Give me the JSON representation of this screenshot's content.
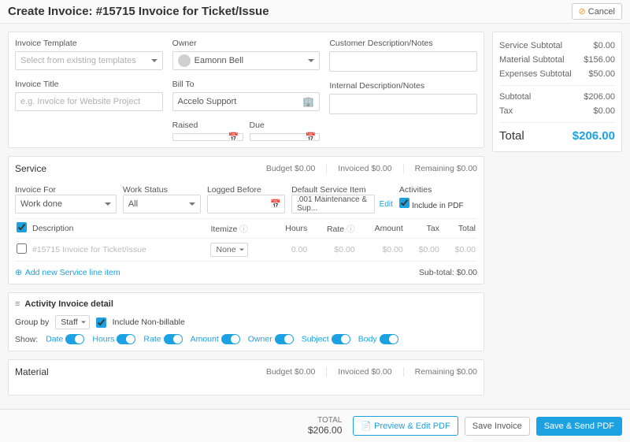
{
  "header": {
    "title": "Create Invoice: #15715 Invoice for Ticket/Issue",
    "cancel": "Cancel"
  },
  "summary": {
    "service_label": "Service Subtotal",
    "service_val": "$0.00",
    "material_label": "Material Subtotal",
    "material_val": "$156.00",
    "expenses_label": "Expenses Subtotal",
    "expenses_val": "$50.00",
    "subtotal_label": "Subtotal",
    "subtotal_val": "$206.00",
    "tax_label": "Tax",
    "tax_val": "$0.00",
    "total_label": "Total",
    "total_val": "$206.00"
  },
  "top": {
    "template_label": "Invoice Template",
    "template_placeholder": "Select from existing templates",
    "title_label": "Invoice Title",
    "title_placeholder": "e.g. Invoice for Website Project",
    "owner_label": "Owner",
    "owner_value": "Eamonn Bell",
    "billto_label": "Bill To",
    "billto_value": "Accelo Support",
    "raised_label": "Raised",
    "due_label": "Due",
    "cust_notes_label": "Customer Description/Notes",
    "int_notes_label": "Internal Description/Notes"
  },
  "service": {
    "title": "Service",
    "budget": "Budget $0.00",
    "invoiced": "Invoiced $0.00",
    "remaining": "Remaining $0.00",
    "invoice_for_label": "Invoice For",
    "invoice_for_value": "Work done",
    "work_status_label": "Work Status",
    "work_status_value": "All",
    "logged_before_label": "Logged Before",
    "default_item_label": "Default Service Item",
    "default_item_value": ".001 Maintenance & Sup...",
    "edit": "Edit",
    "activities_label": "Activities",
    "include_pdf": "Include in PDF",
    "col_desc": "Description",
    "col_itemize": "Itemize",
    "col_hours": "Hours",
    "col_rate": "Rate",
    "col_amount": "Amount",
    "col_tax": "Tax",
    "col_total": "Total",
    "row_desc": "#15715 Invoice for Ticket/Issue",
    "row_itemize": "None",
    "row_hours": "0.00",
    "row_rate": "$0.00",
    "row_amount": "$0.00",
    "row_tax": "$0.00",
    "row_total": "$0.00",
    "add_link": "Add new Service line item",
    "subtotal": "Sub-total: $0.00"
  },
  "detail": {
    "title": "Activity Invoice detail",
    "groupby_label": "Group by",
    "groupby_value": "Staff",
    "include_nonbill": "Include Non-billable",
    "show": "Show:",
    "toggles": [
      "Date",
      "Hours",
      "Rate",
      "Amount",
      "Owner",
      "Subject",
      "Body"
    ]
  },
  "material": {
    "title": "Material",
    "budget": "Budget $0.00",
    "invoiced": "Invoiced $0.00",
    "remaining": "Remaining $0.00"
  },
  "footer": {
    "total_label": "TOTAL",
    "total_val": "$206.00",
    "preview": "Preview & Edit PDF",
    "save": "Save Invoice",
    "send": "Save & Send PDF"
  }
}
